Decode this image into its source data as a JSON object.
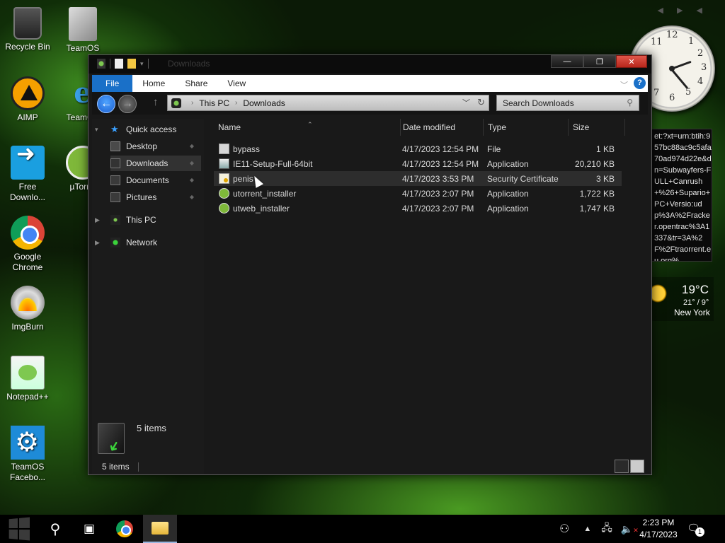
{
  "desktop": {
    "icons": [
      {
        "label": "Recycle Bin"
      },
      {
        "label": "TeamOS"
      },
      {
        "label": "AIMP"
      },
      {
        "label": "TeamOS"
      },
      {
        "label": "Free Downlo..."
      },
      {
        "label": "µTorr..."
      },
      {
        "label": "Google Chrome"
      },
      {
        "label": "ImgBurn"
      },
      {
        "label": "Notepad++"
      },
      {
        "label": "TeamOS Facebo..."
      }
    ]
  },
  "gadgets": {
    "torrent_text": "et:?xt=urn:btih:957bc88ac9c5afa70ad974d22e&dn=Subwayfers-FULL+Canrush+%26+Supario+PC+Versio:udp%3A%2Fracker.opentrac%3A1337&tr=3A%2F%2Ftraorrent.eu.org%",
    "weather": {
      "temp": "19°C",
      "range": "21° / 9°",
      "city": "New York"
    }
  },
  "window": {
    "title": "Downloads",
    "buttons": {
      "minimize": "—",
      "maximize": "❐",
      "close": "✕"
    },
    "ribbon": {
      "tabs": [
        {
          "label": "File"
        },
        {
          "label": "Home"
        },
        {
          "label": "Share"
        },
        {
          "label": "View"
        }
      ],
      "help": "?"
    },
    "address": {
      "crumbs": [
        "This PC",
        "Downloads"
      ]
    },
    "search": {
      "placeholder": "Search Downloads"
    },
    "nav_tree": {
      "quick_access": "Quick access",
      "desktop": "Desktop",
      "downloads": "Downloads",
      "documents": "Documents",
      "pictures": "Pictures",
      "this_pc": "This PC",
      "network": "Network"
    },
    "columns": {
      "name": "Name",
      "date": "Date modified",
      "type": "Type",
      "size": "Size"
    },
    "files": [
      {
        "name": "bypass",
        "date": "4/17/2023 12:54 PM",
        "type": "File",
        "size": "1 KB"
      },
      {
        "name": "IE11-Setup-Full-64bit",
        "date": "4/17/2023 12:54 PM",
        "type": "Application",
        "size": "20,210 KB"
      },
      {
        "name": "penis",
        "date": "4/17/2023 3:53 PM",
        "type": "Security Certificate",
        "size": "3 KB"
      },
      {
        "name": "utorrent_installer",
        "date": "4/17/2023 2:07 PM",
        "type": "Application",
        "size": "1,722 KB"
      },
      {
        "name": "utweb_installer",
        "date": "4/17/2023 2:07 PM",
        "type": "Application",
        "size": "1,747 KB"
      }
    ],
    "details_count": "5 items",
    "status_count": "5 items"
  },
  "taskbar": {
    "time": "2:23 PM",
    "date": "4/17/2023",
    "notification_count": "1"
  }
}
